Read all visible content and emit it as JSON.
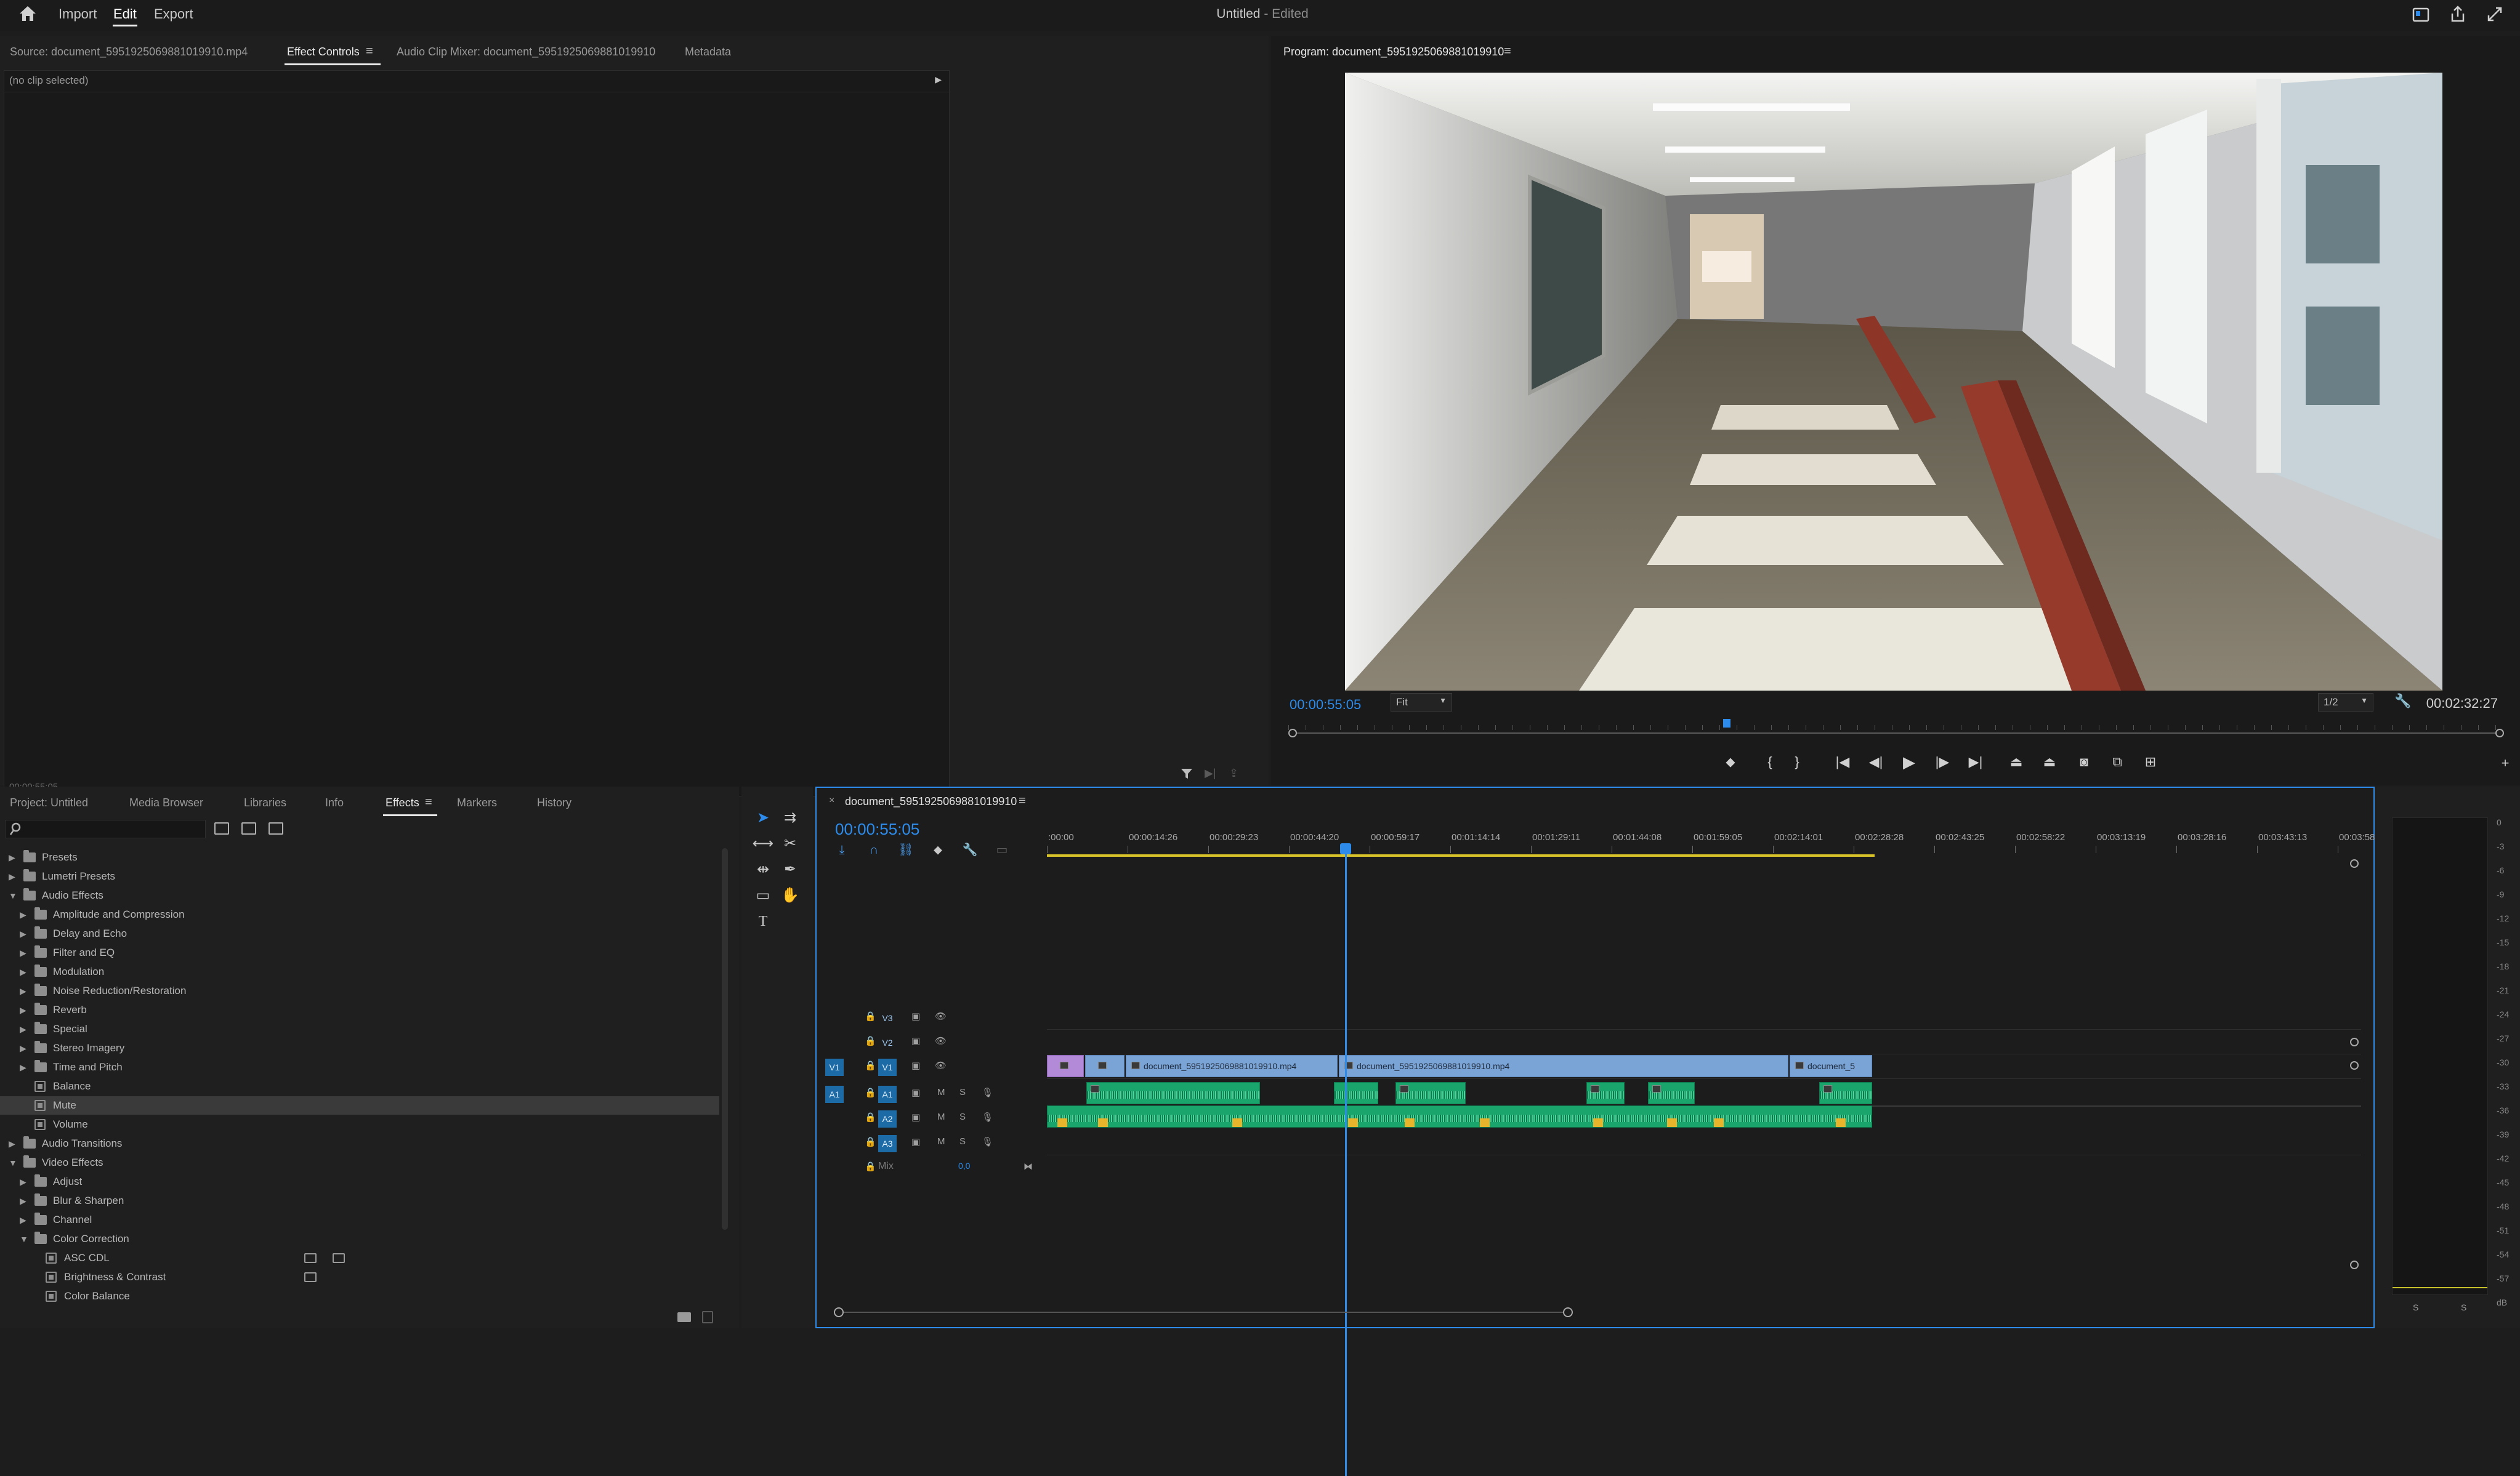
{
  "topbar": {
    "import": "Import",
    "edit": "Edit",
    "export": "Export",
    "title": "Untitled",
    "title_suffix": "- Edited"
  },
  "source_panel": {
    "tabs": [
      {
        "label": "Source: document_5951925069881019910.mp4"
      },
      {
        "label": "Effect Controls"
      },
      {
        "label": "Audio Clip Mixer: document_5951925069881019910"
      },
      {
        "label": "Metadata"
      }
    ],
    "no_clip": "(no clip selected)",
    "timecode": "00:00:55:05"
  },
  "program": {
    "tab": "Program: document_5951925069881019910",
    "timecode": "00:00:55:05",
    "fit": "Fit",
    "resolution": "1/2",
    "duration": "00:02:32:27"
  },
  "project_panel": {
    "tabs": [
      "Project: Untitled",
      "Media Browser",
      "Libraries",
      "Info",
      "Effects",
      "Markers",
      "History"
    ],
    "tree": [
      {
        "label": "Presets",
        "level": 0,
        "type": "folder",
        "expanded": false
      },
      {
        "label": "Lumetri Presets",
        "level": 0,
        "type": "folder",
        "expanded": false
      },
      {
        "label": "Audio Effects",
        "level": 0,
        "type": "folder",
        "expanded": true
      },
      {
        "label": "Amplitude and Compression",
        "level": 1,
        "type": "folder",
        "expanded": false
      },
      {
        "label": "Delay and Echo",
        "level": 1,
        "type": "folder",
        "expanded": false
      },
      {
        "label": "Filter and EQ",
        "level": 1,
        "type": "folder",
        "expanded": false
      },
      {
        "label": "Modulation",
        "level": 1,
        "type": "folder",
        "expanded": false
      },
      {
        "label": "Noise Reduction/Restoration",
        "level": 1,
        "type": "folder",
        "expanded": false
      },
      {
        "label": "Reverb",
        "level": 1,
        "type": "folder",
        "expanded": false
      },
      {
        "label": "Special",
        "level": 1,
        "type": "folder",
        "expanded": false
      },
      {
        "label": "Stereo Imagery",
        "level": 1,
        "type": "folder",
        "expanded": false
      },
      {
        "label": "Time and Pitch",
        "level": 1,
        "type": "folder",
        "expanded": false
      },
      {
        "label": "Balance",
        "level": 1,
        "type": "effect"
      },
      {
        "label": "Mute",
        "level": 1,
        "type": "effect",
        "selected": true
      },
      {
        "label": "Volume",
        "level": 1,
        "type": "effect"
      },
      {
        "label": "Audio Transitions",
        "level": 0,
        "type": "folder",
        "expanded": false
      },
      {
        "label": "Video Effects",
        "level": 0,
        "type": "folder",
        "expanded": true
      },
      {
        "label": "Adjust",
        "level": 1,
        "type": "folder",
        "expanded": false
      },
      {
        "label": "Blur & Sharpen",
        "level": 1,
        "type": "folder",
        "expanded": false
      },
      {
        "label": "Channel",
        "level": 1,
        "type": "folder",
        "expanded": false
      },
      {
        "label": "Color Correction",
        "level": 1,
        "type": "folder",
        "expanded": true
      },
      {
        "label": "ASC CDL",
        "level": 2,
        "type": "effect",
        "acc": 2
      },
      {
        "label": "Brightness & Contrast",
        "level": 2,
        "type": "effect",
        "acc": 1
      },
      {
        "label": "Color Balance",
        "level": 2,
        "type": "effect"
      }
    ]
  },
  "timeline": {
    "sequence_tab": "document_5951925069881019910",
    "timecode": "00:00:55:05",
    "ruler": [
      ":00:00",
      "00:00:14:26",
      "00:00:29:23",
      "00:00:44:20",
      "00:00:59:17",
      "00:01:14:14",
      "00:01:29:11",
      "00:01:44:08",
      "00:01:59:05",
      "00:02:14:01",
      "00:02:28:28",
      "00:02:43:25",
      "00:02:58:22",
      "00:03:13:19",
      "00:03:28:16",
      "00:03:43:13",
      "00:03:58"
    ],
    "tracks": {
      "v3": "V3",
      "v2": "V2",
      "v1": "V1",
      "v1_src": "V1",
      "a1": "A1",
      "a2": "A2",
      "a3": "A3",
      "a1_src": "A1",
      "m": "M",
      "s": "S",
      "mix_label": "Mix",
      "mix_value": "0,0"
    },
    "clips": [
      {
        "label": "document_5951925069881019910.mp4"
      },
      {
        "label": "document_5951925069881019910.mp4"
      },
      {
        "label": "document_5"
      }
    ]
  },
  "meters": {
    "scale": [
      "0",
      "-3",
      "-6",
      "-9",
      "-12",
      "-15",
      "-18",
      "-21",
      "-24",
      "-27",
      "-30",
      "-33",
      "-36",
      "-39",
      "-42",
      "-45",
      "-48",
      "-51",
      "-54",
      "-57",
      "dB"
    ],
    "solo_left": "S",
    "solo_right": "S"
  }
}
